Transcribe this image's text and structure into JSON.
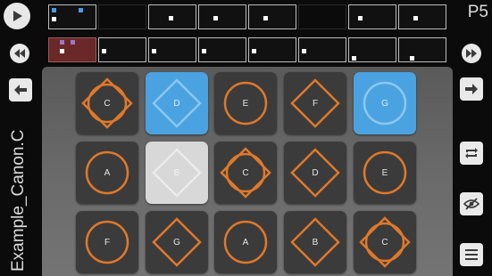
{
  "page_label": "P5",
  "song_title": "Example_Canon.C",
  "colors": {
    "accent_orange": "#e0782a",
    "pad_blue": "#4aa3e0",
    "active_cell": "#6b2828"
  },
  "controls": {
    "play": "play-icon",
    "rewind": "rewind-icon",
    "fast_forward": "fast-forward-icon",
    "back": "arrow-left-icon",
    "forward": "arrow-right-icon",
    "loop": "loop-icon",
    "hide": "eye-off-icon",
    "menu": "menu-icon"
  },
  "pads": [
    [
      {
        "note": "C",
        "shape": "both",
        "state": "normal"
      },
      {
        "note": "D",
        "shape": "diamond",
        "state": "blue"
      },
      {
        "note": "E",
        "shape": "circle",
        "state": "normal"
      },
      {
        "note": "F",
        "shape": "diamond",
        "state": "normal"
      },
      {
        "note": "G",
        "shape": "circle",
        "state": "blue"
      }
    ],
    [
      {
        "note": "A",
        "shape": "circle",
        "state": "normal"
      },
      {
        "note": "B",
        "shape": "diamond",
        "state": "light"
      },
      {
        "note": "C",
        "shape": "both",
        "state": "normal"
      },
      {
        "note": "D",
        "shape": "diamond",
        "state": "normal"
      },
      {
        "note": "E",
        "shape": "circle",
        "state": "normal"
      }
    ],
    [
      {
        "note": "F",
        "shape": "circle",
        "state": "normal"
      },
      {
        "note": "G",
        "shape": "diamond",
        "state": "normal"
      },
      {
        "note": "A",
        "shape": "circle",
        "state": "normal"
      },
      {
        "note": "B",
        "shape": "diamond",
        "state": "normal"
      },
      {
        "note": "C",
        "shape": "both",
        "state": "normal"
      }
    ]
  ]
}
